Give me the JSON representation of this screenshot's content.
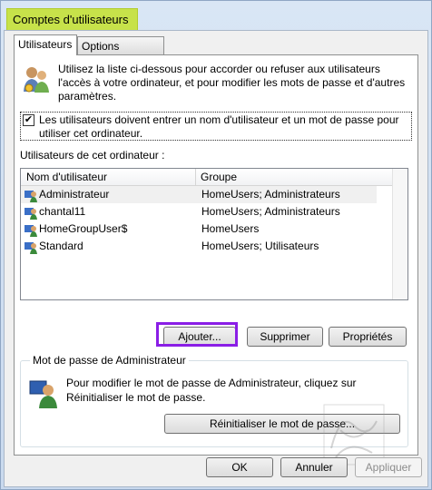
{
  "window": {
    "title": "Comptes d'utilisateurs"
  },
  "tabs": [
    {
      "label": "Utilisateurs"
    },
    {
      "label": "Options avancées"
    }
  ],
  "intro": {
    "text": "Utilisez la liste ci-dessous pour accorder ou refuser aux utilisateurs l'accès à votre ordinateur, et pour modifier les mots de passe et d'autres paramètres."
  },
  "checkbox": {
    "checked": true,
    "label": "Les utilisateurs doivent entrer un nom d'utilisateur et un mot de passe pour utiliser cet ordinateur."
  },
  "users_label": "Utilisateurs de cet ordinateur :",
  "table": {
    "headers": [
      "Nom d'utilisateur",
      "Groupe"
    ],
    "rows": [
      {
        "name": "Administrateur",
        "group": "HomeUsers; Administrateurs"
      },
      {
        "name": "chantal11",
        "group": "HomeUsers; Administrateurs"
      },
      {
        "name": "HomeGroupUser$",
        "group": "HomeUsers"
      },
      {
        "name": "Standard",
        "group": "HomeUsers; Utilisateurs"
      }
    ]
  },
  "buttons": {
    "add": "Ajouter...",
    "remove": "Supprimer",
    "properties": "Propriétés"
  },
  "admin_group": {
    "label": "Mot de passe de Administrateur",
    "text": "Pour modifier le mot de passe de Administrateur, cliquez sur Réinitialiser le mot de passe.",
    "reset": "Réinitialiser le mot de passe..."
  },
  "footer": {
    "ok": "OK",
    "cancel": "Annuler",
    "apply": "Appliquer"
  },
  "colors": {
    "title_highlight": "#c7e24a",
    "annotation": "#8a1ee6"
  }
}
